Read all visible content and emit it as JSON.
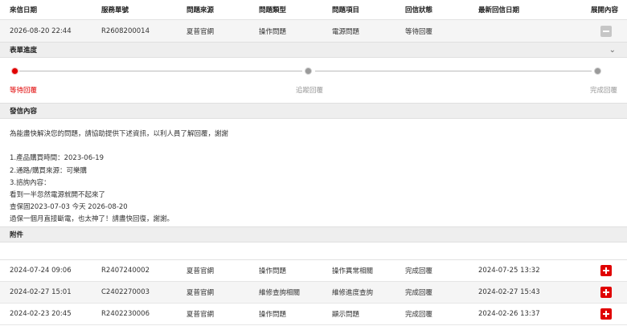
{
  "table": {
    "headers": [
      "來信日期",
      "服務單號",
      "問題來源",
      "問題類型",
      "問題項目",
      "回信狀態",
      "最新回信日期",
      "展開內容"
    ],
    "active_row": {
      "date": "2026-08-20 22:44",
      "ticket": "R2608200014",
      "source": "夏普官網",
      "type": "操作問題",
      "item": "電源問題",
      "status": "等待回覆",
      "latest_reply": ""
    },
    "rows": [
      {
        "date": "2024-07-24 09:06",
        "ticket": "R2407240002",
        "source": "夏普官網",
        "type": "操作問題",
        "item": "操作異常相關",
        "status": "完成回覆",
        "latest_reply": "2024-07-25 13:32"
      },
      {
        "date": "2024-02-27 15:01",
        "ticket": "C2402270003",
        "source": "夏普官網",
        "type": "維修查詢相關",
        "item": "維修進度查詢",
        "status": "完成回覆",
        "latest_reply": "2024-02-27 15:43"
      },
      {
        "date": "2024-02-23 20:45",
        "ticket": "R2402230006",
        "source": "夏普官網",
        "type": "操作問題",
        "item": "顯示問題",
        "status": "完成回覆",
        "latest_reply": "2024-02-26 13:37"
      }
    ]
  },
  "progress": {
    "title": "表單進度",
    "current_step": 1,
    "steps": [
      "等待回覆",
      "追蹤回覆",
      "完成回覆"
    ]
  },
  "message": {
    "title": "發信內容",
    "lines": [
      "為能盡快解決您的問題，請協助提供下述資訊，以利人員了解回覆，謝謝",
      "",
      "1.產品購買時間：2023-06-19",
      "2.通路/購買來源：可樂購",
      "3.諮詢內容：",
      "看到一半忽然電源就開不起來了",
      "查保固2023-07-03 今天 2026-08-20",
      "過保一個月直接斷電，也太神了！請盡快回復，謝謝。"
    ]
  },
  "attachments": {
    "title": "附件"
  },
  "colors": {
    "accent": "#e00000",
    "inactive_dot": "#9a9a9a",
    "row_alt": "#f5f5f5"
  },
  "icons": {
    "collapse": "minus-square-icon",
    "expand": "plus-square-icon",
    "progress_toggle": "chevron-down-icon"
  }
}
